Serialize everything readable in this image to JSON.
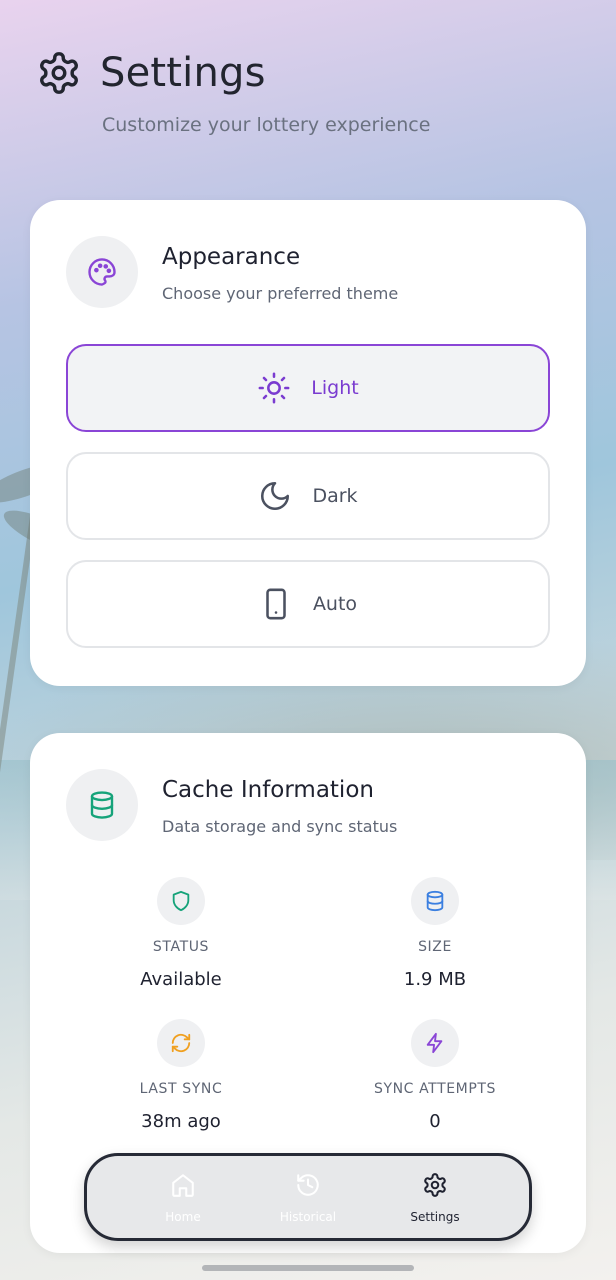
{
  "header": {
    "title": "Settings",
    "subtitle": "Customize your lottery experience",
    "icon": "gear-icon"
  },
  "appearance": {
    "title": "Appearance",
    "description": "Choose your preferred theme",
    "icon": "palette-icon",
    "accent": "#8a45d6",
    "options": [
      {
        "label": "Light",
        "icon": "sun-icon",
        "selected": true
      },
      {
        "label": "Dark",
        "icon": "moon-icon",
        "selected": false
      },
      {
        "label": "Auto",
        "icon": "phone-icon",
        "selected": false
      }
    ]
  },
  "cache": {
    "title": "Cache Information",
    "description": "Data storage and sync status",
    "icon": "database-icon",
    "stats": [
      {
        "label": "STATUS",
        "value": "Available",
        "icon": "shield-icon",
        "color": "#16a37a"
      },
      {
        "label": "SIZE",
        "value": "1.9 MB",
        "icon": "database-icon",
        "color": "#3b7fe0"
      },
      {
        "label": "LAST SYNC",
        "value": "38m ago",
        "icon": "refresh-icon",
        "color": "#f0a020"
      },
      {
        "label": "SYNC ATTEMPTS",
        "value": "0",
        "icon": "lightning-icon",
        "color": "#8a45d6"
      }
    ]
  },
  "nav": {
    "items": [
      {
        "label": "Home",
        "icon": "home-icon",
        "active": false
      },
      {
        "label": "Historical",
        "icon": "history-icon",
        "active": false
      },
      {
        "label": "Settings",
        "icon": "gear-icon",
        "active": true
      }
    ]
  }
}
